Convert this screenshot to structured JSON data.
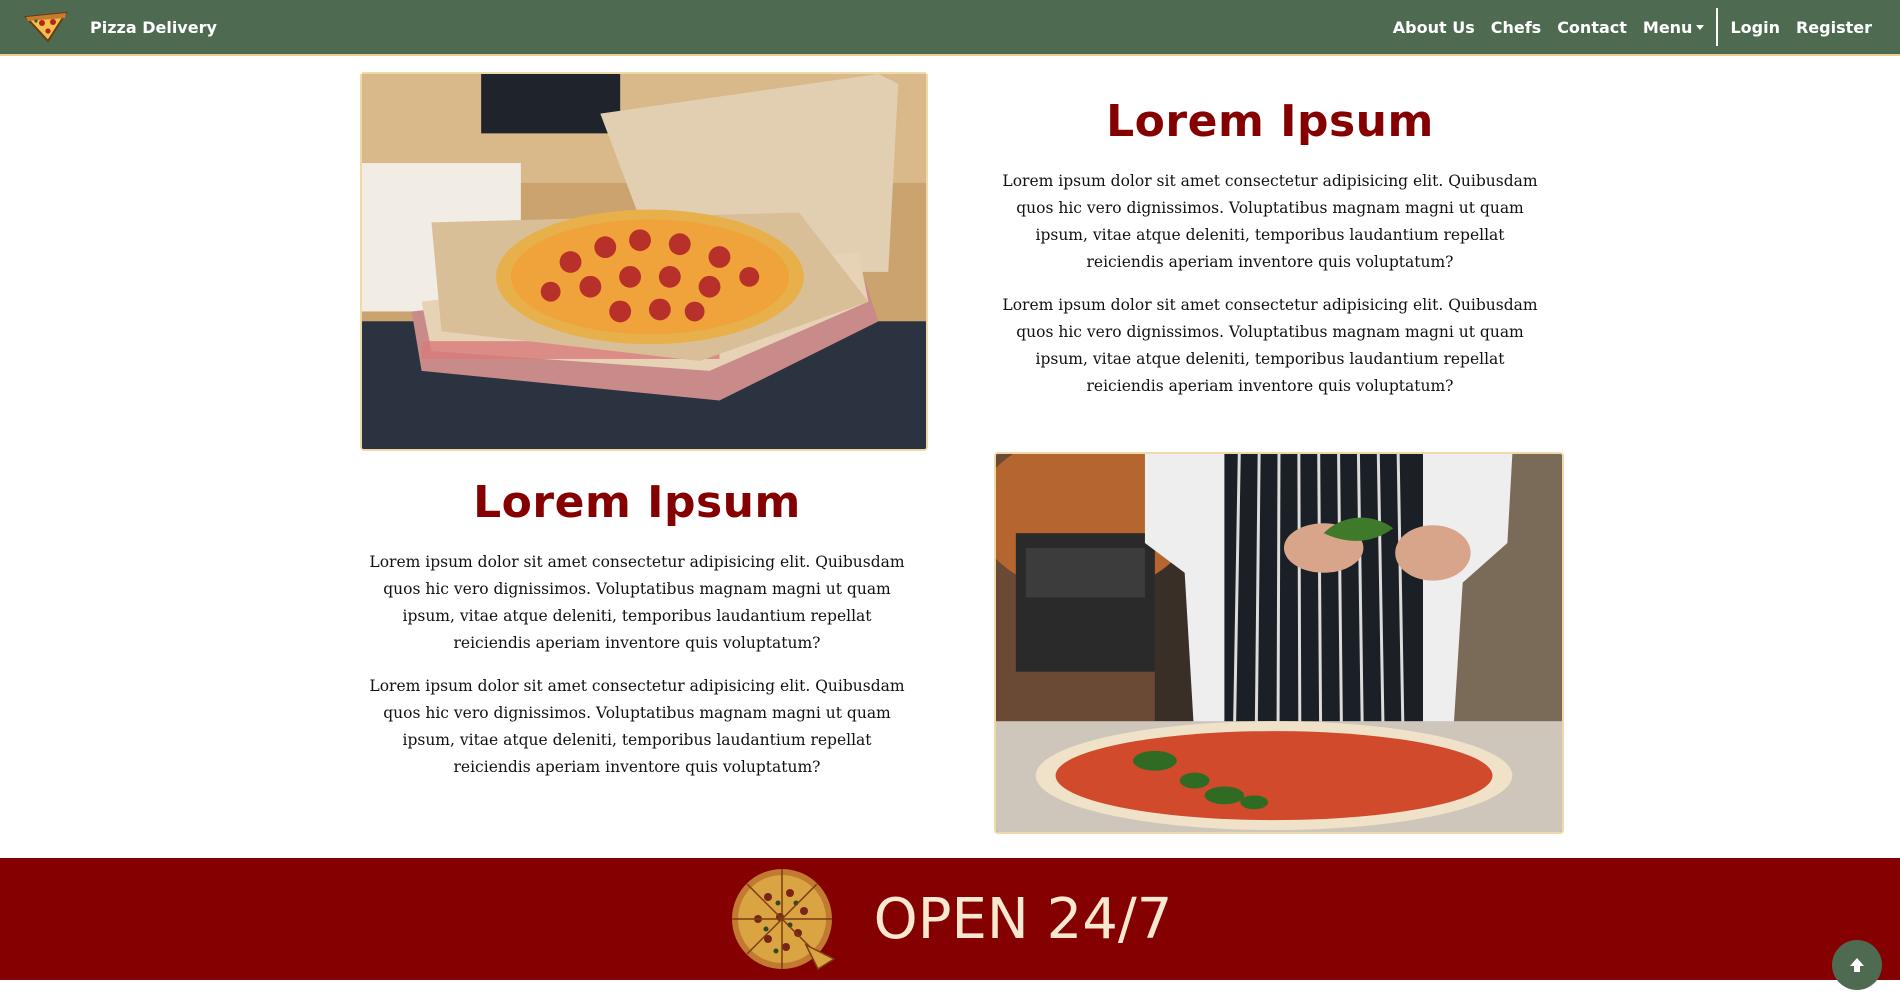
{
  "navbar": {
    "brand_name": "Pizza Delivery",
    "brand_icon": "pizza-slice-icon",
    "links": {
      "about": "About Us",
      "chefs": "Chefs",
      "contact": "Contact",
      "menu": "Menu",
      "login": "Login",
      "register": "Register"
    }
  },
  "sections": [
    {
      "heading": "Lorem Ipsum",
      "paragraphs": [
        "Lorem ipsum dolor sit amet consectetur adipisicing elit. Quibusdam quos hic vero dignissimos. Voluptatibus magnam magni ut quam ipsum, vitae atque deleniti, temporibus laudantium repellat reiciendis aperiam inventore quis voluptatum?",
        "Lorem ipsum dolor sit amet consectetur adipisicing elit. Quibusdam quos hic vero dignissimos. Voluptatibus magnam magni ut quam ipsum, vitae atque deleniti, temporibus laudantium repellat reiciendis aperiam inventore quis voluptatum?"
      ],
      "image": "pizza-box-photo"
    },
    {
      "heading": "Lorem Ipsum",
      "paragraphs": [
        "Lorem ipsum dolor sit amet consectetur adipisicing elit. Quibusdam quos hic vero dignissimos. Voluptatibus magnam magni ut quam ipsum, vitae atque deleniti, temporibus laudantium repellat reiciendis aperiam inventore quis voluptatum?",
        "Lorem ipsum dolor sit amet consectetur adipisicing elit. Quibusdam quos hic vero dignissimos. Voluptatibus magnam magni ut quam ipsum, vitae atque deleniti, temporibus laudantium repellat reiciendis aperiam inventore quis voluptatum?"
      ],
      "image": "chef-pizza-photo"
    }
  ],
  "banner": {
    "text": "OPEN 24/7",
    "icon": "whole-pizza-icon"
  },
  "scroll_top": {
    "icon": "arrow-up-icon"
  },
  "colors": {
    "navbar": "#4e6b51",
    "accent_red": "#850000",
    "cream": "#f7e8cf",
    "border_gold": "#f0d9a8"
  }
}
